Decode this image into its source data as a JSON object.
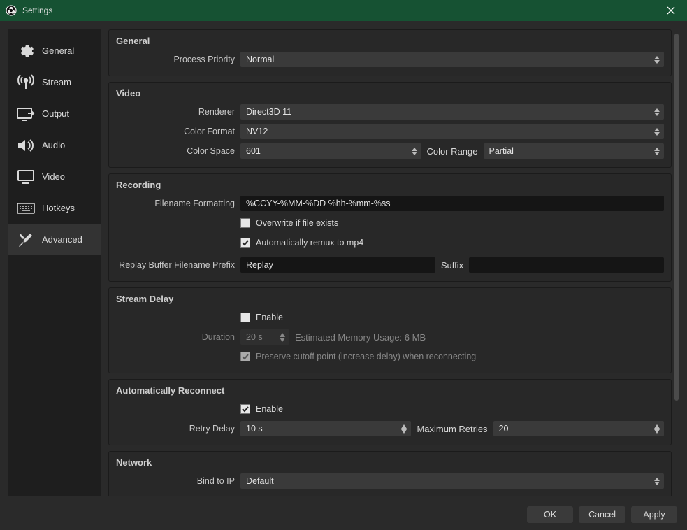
{
  "window": {
    "title": "Settings"
  },
  "sidebar": {
    "items": [
      {
        "label": "General"
      },
      {
        "label": "Stream"
      },
      {
        "label": "Output"
      },
      {
        "label": "Audio"
      },
      {
        "label": "Video"
      },
      {
        "label": "Hotkeys"
      },
      {
        "label": "Advanced"
      }
    ],
    "active_index": 6
  },
  "groups": {
    "general": {
      "title": "General",
      "process_priority_label": "Process Priority",
      "process_priority_value": "Normal"
    },
    "video": {
      "title": "Video",
      "renderer_label": "Renderer",
      "renderer_value": "Direct3D 11",
      "color_format_label": "Color Format",
      "color_format_value": "NV12",
      "color_space_label": "Color Space",
      "color_space_value": "601",
      "color_range_label": "Color Range",
      "color_range_value": "Partial"
    },
    "recording": {
      "title": "Recording",
      "filename_formatting_label": "Filename Formatting",
      "filename_formatting_value": "%CCYY-%MM-%DD %hh-%mm-%ss",
      "overwrite_label": "Overwrite if file exists",
      "overwrite_checked": false,
      "auto_remux_label": "Automatically remux to mp4",
      "auto_remux_checked": true,
      "replay_prefix_label": "Replay Buffer Filename Prefix",
      "replay_prefix_value": "Replay",
      "replay_suffix_label": "Suffix",
      "replay_suffix_value": ""
    },
    "stream_delay": {
      "title": "Stream Delay",
      "enable_label": "Enable",
      "enable_checked": false,
      "duration_label": "Duration",
      "duration_value": "20 s",
      "memory_label": "Estimated Memory Usage: 6 MB",
      "preserve_label": "Preserve cutoff point (increase delay) when reconnecting",
      "preserve_checked": true
    },
    "auto_reconnect": {
      "title": "Automatically Reconnect",
      "enable_label": "Enable",
      "enable_checked": true,
      "retry_delay_label": "Retry Delay",
      "retry_delay_value": "10 s",
      "max_retries_label": "Maximum Retries",
      "max_retries_value": "20"
    },
    "network": {
      "title": "Network",
      "bind_ip_label": "Bind to IP",
      "bind_ip_value": "Default"
    }
  },
  "footer": {
    "ok": "OK",
    "cancel": "Cancel",
    "apply": "Apply"
  }
}
